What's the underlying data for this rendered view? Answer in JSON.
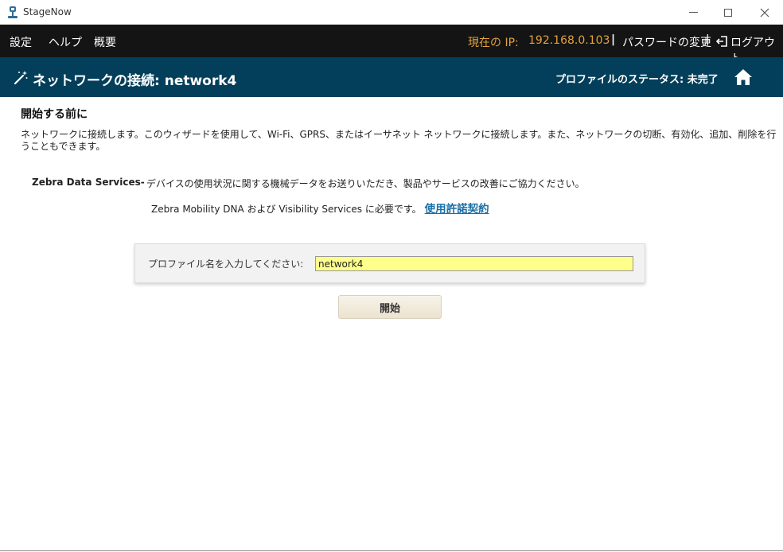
{
  "window": {
    "app_title": "StageNow",
    "minimize_icon": "minimize-icon",
    "maximize_icon": "maximize-icon",
    "close_icon": "close-icon"
  },
  "menubar": {
    "items": [
      {
        "label": "設定"
      },
      {
        "label": "ヘルプ"
      },
      {
        "label": "概要"
      }
    ],
    "ip_label": "現在の IP:",
    "ip_value": "192.168.0.103",
    "separator": "|",
    "change_password": "パスワードの変更",
    "logout": "ログアウト",
    "accent_color": "#e2a23b"
  },
  "header": {
    "title": "ネットワークの接続: network4",
    "profile_status": "プロファイルのステータス: 未完了",
    "background_color": "#033f5a"
  },
  "main": {
    "section_title": "開始する前に",
    "intro_text": "ネットワークに接続します。このウィザードを使用して、Wi-Fi、GPRS、またはイーサネット ネットワークに接続します。また、ネットワークの切断、有効化、追加、削除を行うこともできます。",
    "zebra_data_services": {
      "label": "Zebra Data Services-",
      "line1": "デバイスの使用状況に関する機械データをお送りいただき、製品やサービスの改善にご協力ください。",
      "line2": "Zebra Mobility DNA および Visibility Services に必要です。",
      "license_link": "使用許諾契約"
    },
    "profile": {
      "label": "プロファイル名を入力してください:",
      "value": "network4"
    },
    "start_button": "開始"
  }
}
